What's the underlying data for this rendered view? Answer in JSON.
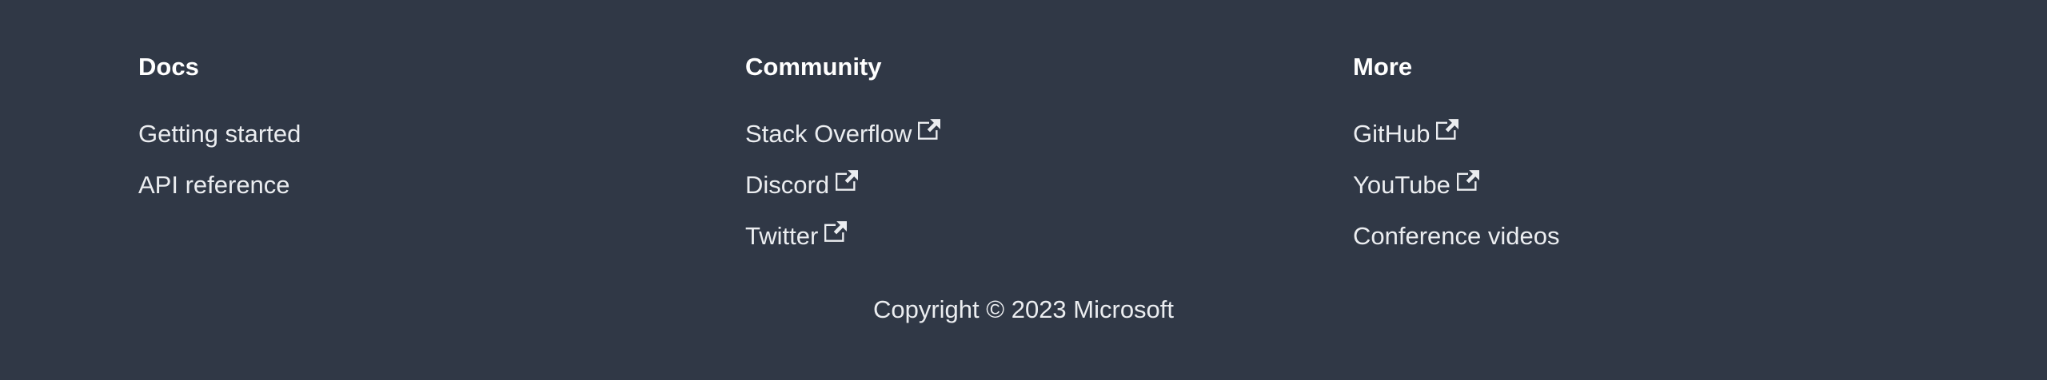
{
  "footer": {
    "columns": [
      {
        "title": "Docs",
        "links": [
          {
            "label": "Getting started",
            "external": false
          },
          {
            "label": "API reference",
            "external": false
          }
        ]
      },
      {
        "title": "Community",
        "links": [
          {
            "label": "Stack Overflow",
            "external": true
          },
          {
            "label": "Discord",
            "external": true
          },
          {
            "label": "Twitter",
            "external": true
          }
        ]
      },
      {
        "title": "More",
        "links": [
          {
            "label": "GitHub",
            "external": true
          },
          {
            "label": "YouTube",
            "external": true
          },
          {
            "label": "Conference videos",
            "external": false
          }
        ]
      }
    ],
    "copyright": "Copyright © 2023 Microsoft",
    "colors": {
      "background": "#303846",
      "text": "#ebedf0",
      "heading": "#ffffff"
    }
  }
}
